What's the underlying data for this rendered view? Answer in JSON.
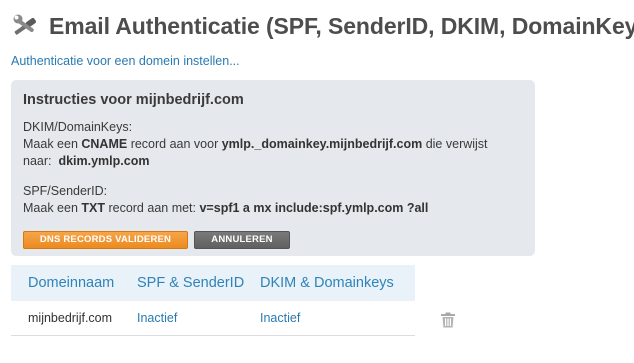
{
  "header": {
    "icon": "wrench-screwdriver-icon",
    "title": "Email Authenticatie (SPF, SenderID, DKIM, DomainKeys):"
  },
  "setup_link": "Authenticatie voor een domein instellen...",
  "instructions": {
    "title": "Instructies voor mijnbedrijf.com",
    "dkim": {
      "heading": "DKIM/DomainKeys:",
      "line1_prefix": "Maak een ",
      "line1_type": "CNAME",
      "line1_mid": " record aan voor ",
      "line1_host": "ymlp._domainkey.mijnbedrijf.com",
      "line1_suffix": " die verwijst",
      "line2_prefix": "naar: ",
      "line2_target": "dkim.ymlp.com"
    },
    "spf": {
      "heading": "SPF/SenderID:",
      "line_prefix": "Maak een ",
      "line_type": "TXT",
      "line_mid": " record aan met: ",
      "line_value": "v=spf1 a mx include:spf.ymlp.com ?all"
    },
    "validate_button": "DNS records valideren",
    "cancel_button": "Annuleren"
  },
  "table": {
    "columns": [
      "Domeinnaam",
      "SPF & SenderID",
      "DKIM & Domainkeys"
    ],
    "rows": [
      {
        "domain": "mijnbedrijf.com",
        "spf_status": "Inactief",
        "dkim_status": "Inactief",
        "action_icon": "trash-icon"
      }
    ]
  },
  "colors": {
    "link": "#2a7ab0",
    "panel_bg": "#e5e8ec",
    "primary_button": "#ec8a1e",
    "secondary_button": "#666666",
    "table_header_bg": "#e9f2f8"
  }
}
